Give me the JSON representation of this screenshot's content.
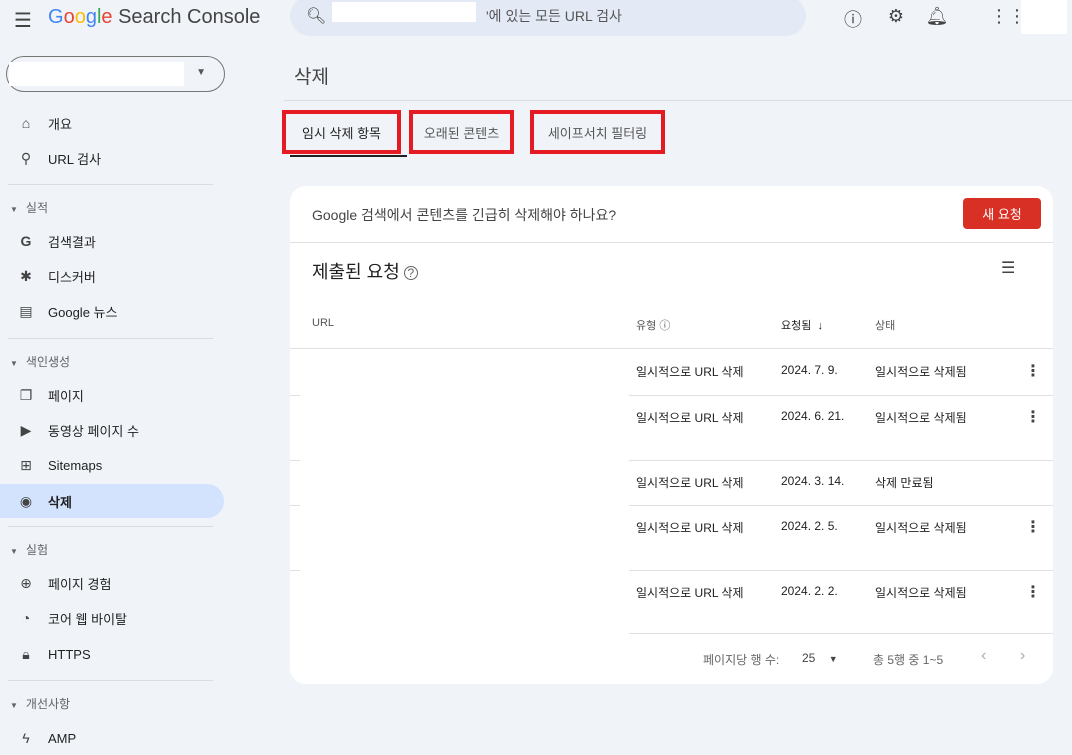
{
  "header": {
    "app_name": "Search Console",
    "logo": "Google",
    "search_placeholder": "'에 있는 모든 URL 검사",
    "icons": [
      "menu-icon",
      "search-icon",
      "help-icon",
      "admin-settings-icon",
      "bell-icon",
      "apps-icon"
    ]
  },
  "sidebar": {
    "top": [
      {
        "label": "개요",
        "icon": "home-icon"
      },
      {
        "label": "URL 검사",
        "icon": "search-icon"
      }
    ],
    "sections": [
      {
        "title": "실적",
        "items": [
          {
            "label": "검색결과",
            "icon": "google-icon"
          },
          {
            "label": "디스커버",
            "icon": "asterisk-icon"
          },
          {
            "label": "Google 뉴스",
            "icon": "news-icon"
          }
        ]
      },
      {
        "title": "색인생성",
        "items": [
          {
            "label": "페이지",
            "icon": "pages-icon"
          },
          {
            "label": "동영상 페이지 수",
            "icon": "video-icon"
          },
          {
            "label": "Sitemaps",
            "icon": "sitemap-icon"
          },
          {
            "label": "삭제",
            "icon": "eye-off-icon",
            "active": true
          }
        ]
      },
      {
        "title": "실험",
        "items": [
          {
            "label": "페이지 경험",
            "icon": "plus-circle-icon"
          },
          {
            "label": "코어 웹 바이탈",
            "icon": "gauge-icon"
          },
          {
            "label": "HTTPS",
            "icon": "lock-icon"
          }
        ]
      },
      {
        "title": "개선사항",
        "items": [
          {
            "label": "AMP",
            "icon": "bolt-icon"
          }
        ]
      }
    ]
  },
  "page": {
    "title": "삭제",
    "tabs": [
      "임시 삭제 항목",
      "오래된 콘텐츠",
      "세이프서치 필터링"
    ],
    "active_tab": 0,
    "highlight_color": "#e41b23"
  },
  "card": {
    "question": "Google 검색에서 콘텐츠를 긴급히 삭제해야 하나요?",
    "new_request": "새 요청",
    "accent": "#d93025",
    "section_title": "제출된 요청",
    "columns": [
      "URL",
      "유형",
      "요청됨",
      "상태"
    ],
    "rows": [
      {
        "type": "일시적으로 URL 삭제",
        "date": "2024. 7. 9.",
        "status": "일시적으로 삭제됨",
        "menu": true
      },
      {
        "type": "일시적으로 URL 삭제",
        "date": "2024. 6. 21.",
        "status": "일시적으로 삭제됨",
        "menu": true
      },
      {
        "type": "일시적으로 URL 삭제",
        "date": "2024. 3. 14.",
        "status": "삭제 만료됨",
        "menu": false
      },
      {
        "type": "일시적으로 URL 삭제",
        "date": "2024. 2. 5.",
        "status": "일시적으로 삭제됨",
        "menu": true
      },
      {
        "type": "일시적으로 URL 삭제",
        "date": "2024. 2. 2.",
        "status": "일시적으로 삭제됨",
        "menu": true
      }
    ],
    "footer": {
      "rows_per_page_label": "페이지당 행 수:",
      "rows_per_page": "25",
      "range": "총 5행 중 1~5"
    }
  }
}
